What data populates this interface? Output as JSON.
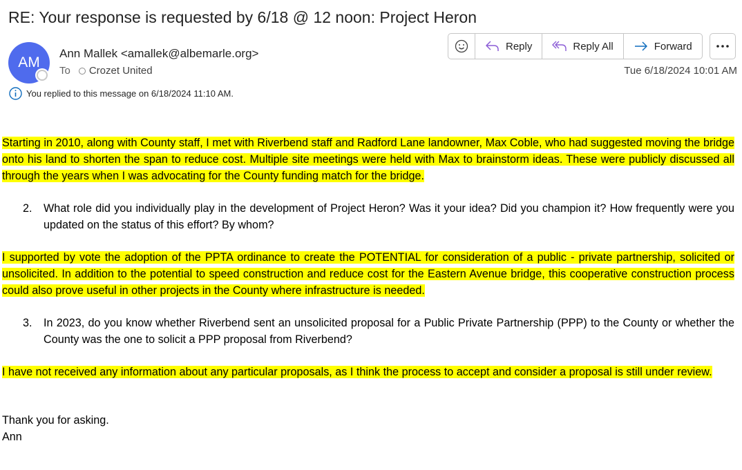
{
  "email": {
    "subject": "RE: Your response is requested by 6/18 @ 12 noon:  Project Heron",
    "sender": {
      "initials": "AM",
      "display": "Ann Mallek <amallek@albemarle.org>"
    },
    "to_label": "To",
    "recipient": "Crozet United",
    "date": "Tue 6/18/2024 10:01 AM",
    "info_banner": "You replied to this message on 6/18/2024 11:10 AM."
  },
  "toolbar": {
    "reply_label": "Reply",
    "reply_all_label": "Reply All",
    "forward_label": "Forward",
    "icons": [
      "emoji-icon",
      "reply-icon",
      "reply-all-icon",
      "forward-icon",
      "more-icon"
    ]
  },
  "body": {
    "answer1": "Starting in 2010, along with County staff, I met with Riverbend staff and Radford Lane landowner, Max Coble, who had suggested moving the bridge onto his land to shorten the span to reduce cost. Multiple site meetings were held with Max to brainstorm ideas. These were publicly discussed all through the years when I was advocating for the County funding match for the bridge.",
    "q2_num": "2.",
    "q2_text": "What role did you individually play in the development of Project Heron?  Was it your idea?  Did you champion it?  How frequently were you updated on the status of this effort?  By whom?",
    "answer2": "I supported by vote the adoption of the PPTA ordinance to create the POTENTIAL for consideration of a public - private partnership, solicited or unsolicited. In addition to the potential to speed construction and reduce cost for the Eastern Avenue bridge, this cooperative construction process could also prove useful in other projects in the County where infrastructure is needed.",
    "q3_num": "3.",
    "q3_text": "In 2023, do you know whether Riverbend sent an unsolicited proposal for a Public Private Partnership (PPP) to the County or whether the County was the one to solicit a PPP proposal from Riverbend?",
    "answer3": "I have not received any information about any particular proposals, as I think the process to accept and consider a proposal is still under review.",
    "closing": "Thank you for asking.",
    "signature": "Ann"
  },
  "colors": {
    "highlight": "#ffff00",
    "avatar": "#4f6bed",
    "icon_accent": "#0f6cbd"
  }
}
